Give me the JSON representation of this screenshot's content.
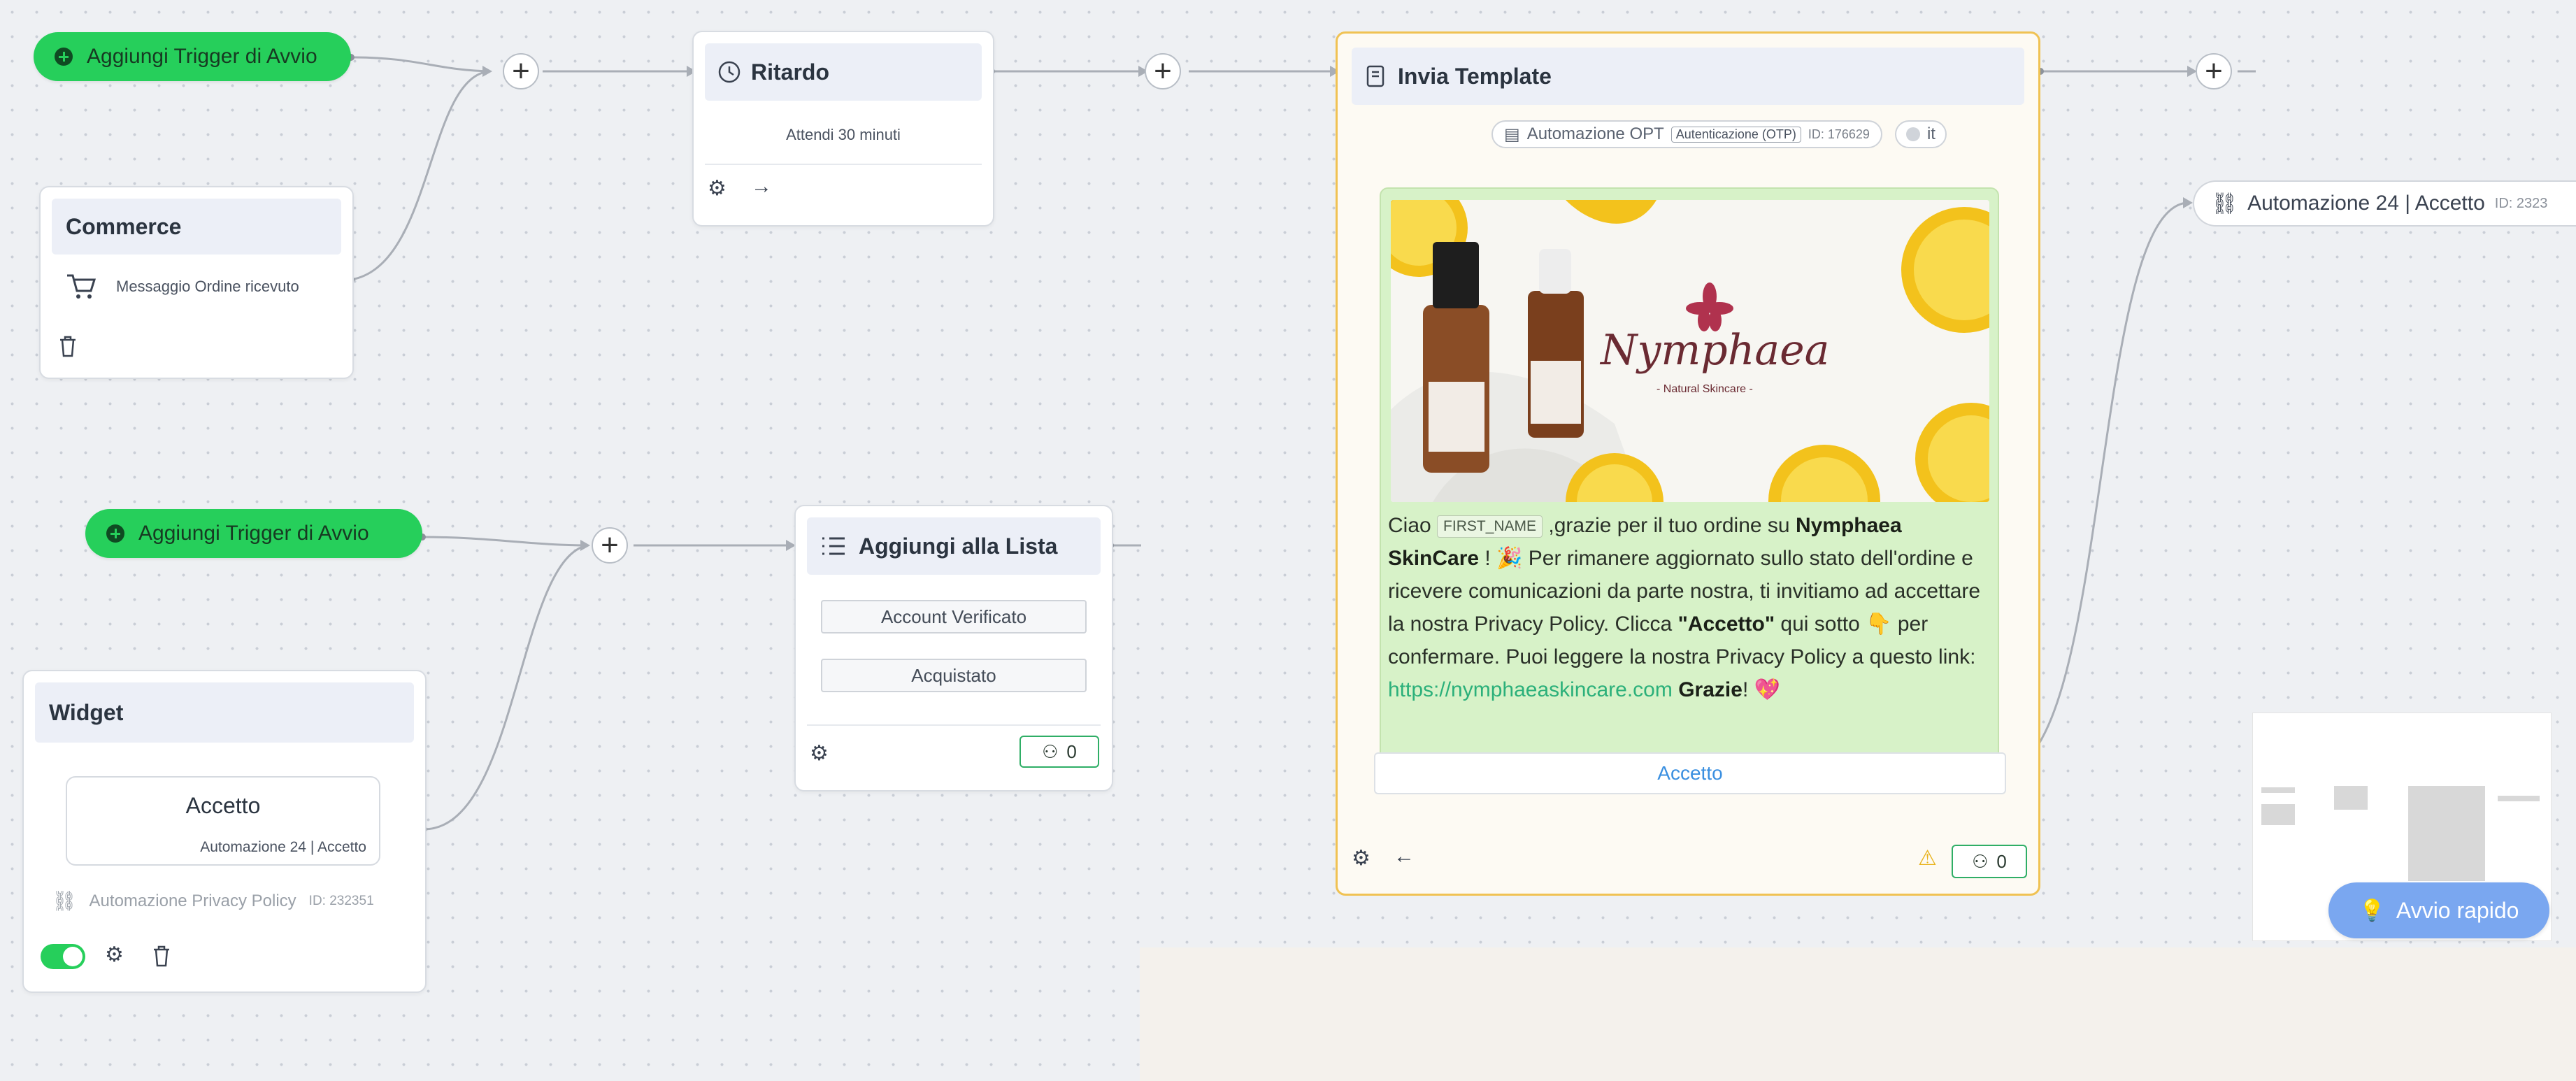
{
  "trigger_1": {
    "label": "Aggiungi Trigger di Avvio"
  },
  "trigger_2": {
    "label": "Aggiungi Trigger di Avvio"
  },
  "commerce": {
    "title": "Commerce",
    "item": "Messaggio Ordine ricevuto"
  },
  "ritardo": {
    "title": "Ritardo",
    "text": "Attendi 30 minuti"
  },
  "lista": {
    "title": "Aggiungi alla Lista",
    "items": [
      "Account Verificato",
      "Acquistato"
    ],
    "count": "0"
  },
  "widget": {
    "title": "Widget",
    "bubble_title": "Accetto",
    "bubble_sub": "Automazione 24 | Accetto",
    "automation": "Automazione Privacy Policy",
    "automation_id": "ID: 232351"
  },
  "template": {
    "title": "Invia Template",
    "meta_name": "Automazione OPT",
    "meta_tag": "Autenticazione (OTP)",
    "meta_id": "ID: 176629",
    "lang": "it",
    "image_brand": "Nymphaea",
    "image_tagline": "- Natural Skincare -",
    "msg_ciao": "Ciao",
    "msg_var": "FIRST_NAME",
    "msg_part1": " ,grazie per il tuo ordine su ",
    "msg_brand": "Nymphaea SkinCare",
    "msg_part2": " ! 🎉 Per rimanere aggiornato sullo stato dell'ordine e ricevere comunicazioni da parte nostra, ti invitiamo ad accettare la nostra Privacy Policy. Clicca ",
    "msg_quote": "\"Accetto\"",
    "msg_part3": " qui sotto 👇 per confermare. Puoi leggere la nostra Privacy Policy a questo link: ",
    "msg_link": "https://nymphaeaskincare.com",
    "msg_thanks": "Grazie",
    "msg_end": "! 💖",
    "button": "Accetto",
    "count": "0"
  },
  "next_node": {
    "label": "Automazione 24 | Accetto",
    "id": "ID: 2323"
  },
  "quick_start": {
    "label": "Avvio rapido"
  },
  "colors": {
    "trigger": "#26cf5b",
    "accent_border": "#f0c253",
    "bubble": "#d7f2c8",
    "link": "#2bb07a",
    "quick_start": "#7aa7f0"
  }
}
